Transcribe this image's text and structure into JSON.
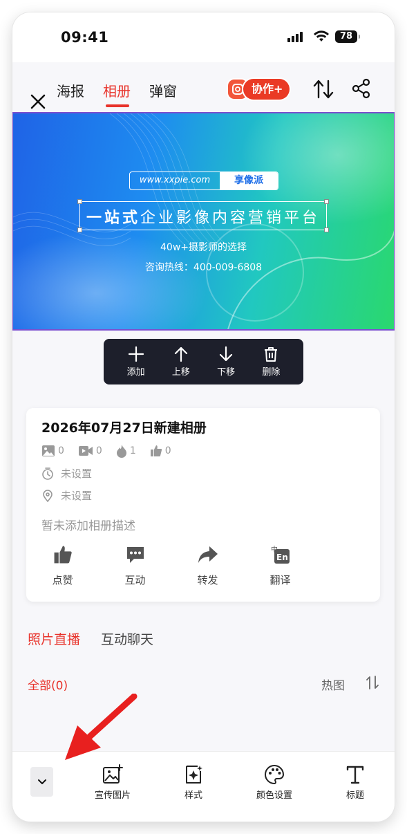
{
  "status_bar": {
    "time": "09:41",
    "battery": "78"
  },
  "top_nav": {
    "tabs": [
      {
        "label": "海报",
        "active": false
      },
      {
        "label": "相册",
        "active": true
      },
      {
        "label": "弹窗",
        "active": false
      }
    ],
    "collab_label": "协作+",
    "icons": [
      "close-icon",
      "collab-icon",
      "sort-icon",
      "share-icon"
    ]
  },
  "banner": {
    "url": "www.xxpie.com",
    "brand": "享像派",
    "headline_highlight": "一站式",
    "headline_rest": "企业影像内容营销平台",
    "subtitle": "40w+摄影师的选择",
    "hotline": "咨询热线：400-009-6808"
  },
  "edit_toolbar": {
    "add": "添加",
    "move_up": "上移",
    "move_down": "下移",
    "delete": "删除"
  },
  "album": {
    "title": "2026年07月27日新建相册",
    "photos": "0",
    "videos": "0",
    "heat": "1",
    "likes": "0",
    "time_setting": "未设置",
    "location_setting": "未设置",
    "description": "暂未添加相册描述",
    "actions": {
      "like": "点赞",
      "interact": "互动",
      "forward": "转发",
      "translate": "翻译"
    }
  },
  "content_tabs": {
    "live": "照片直播",
    "chat": "互动聊天"
  },
  "filter": {
    "all": "全部(0)",
    "hot": "热图"
  },
  "bottom_bar": {
    "promo_image": "宣传图片",
    "style": "样式",
    "color_settings": "颜色设置",
    "title": "标题"
  },
  "colors": {
    "accent": "#e8322a",
    "toolbar_bg": "#1d1f2b",
    "banner_blue": "#1f63e6",
    "banner_green": "#2ad86e"
  }
}
